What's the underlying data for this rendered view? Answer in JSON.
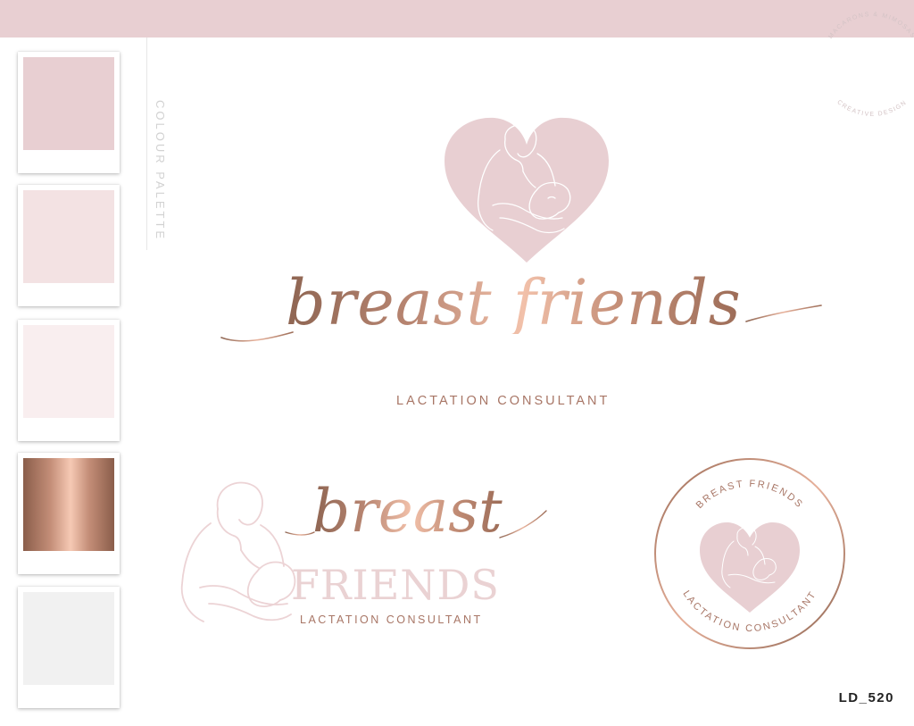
{
  "palette": {
    "label": "COLOUR PALETTE",
    "swatches": [
      {
        "color": "#e8cfd2"
      },
      {
        "color": "#f3e2e3"
      },
      {
        "color": "#f9eeef"
      },
      {
        "color": "rose-gold-gradient"
      },
      {
        "color": "#f1f1f1"
      }
    ]
  },
  "main_logo": {
    "title": "breast friends",
    "subtitle": "LACTATION CONSULTANT"
  },
  "secondary_logo": {
    "line1": "breast",
    "line2": "FRIENDS",
    "subtitle": "LACTATION CONSULTANT"
  },
  "badge_logo": {
    "top_text": "BREAST FRIENDS",
    "bottom_text": "LACTATION CONSULTANT"
  },
  "watermark": {
    "top_text": "MACARONS & MIMOSAS",
    "bottom_text": "CREATIVE DESIGN"
  },
  "product_code": "LD_520",
  "colors": {
    "blush": "#e8cfd2",
    "rose_gold_dark": "#8e6552",
    "rose_gold_light": "#f2c1aa",
    "text_accent": "#a87666"
  }
}
